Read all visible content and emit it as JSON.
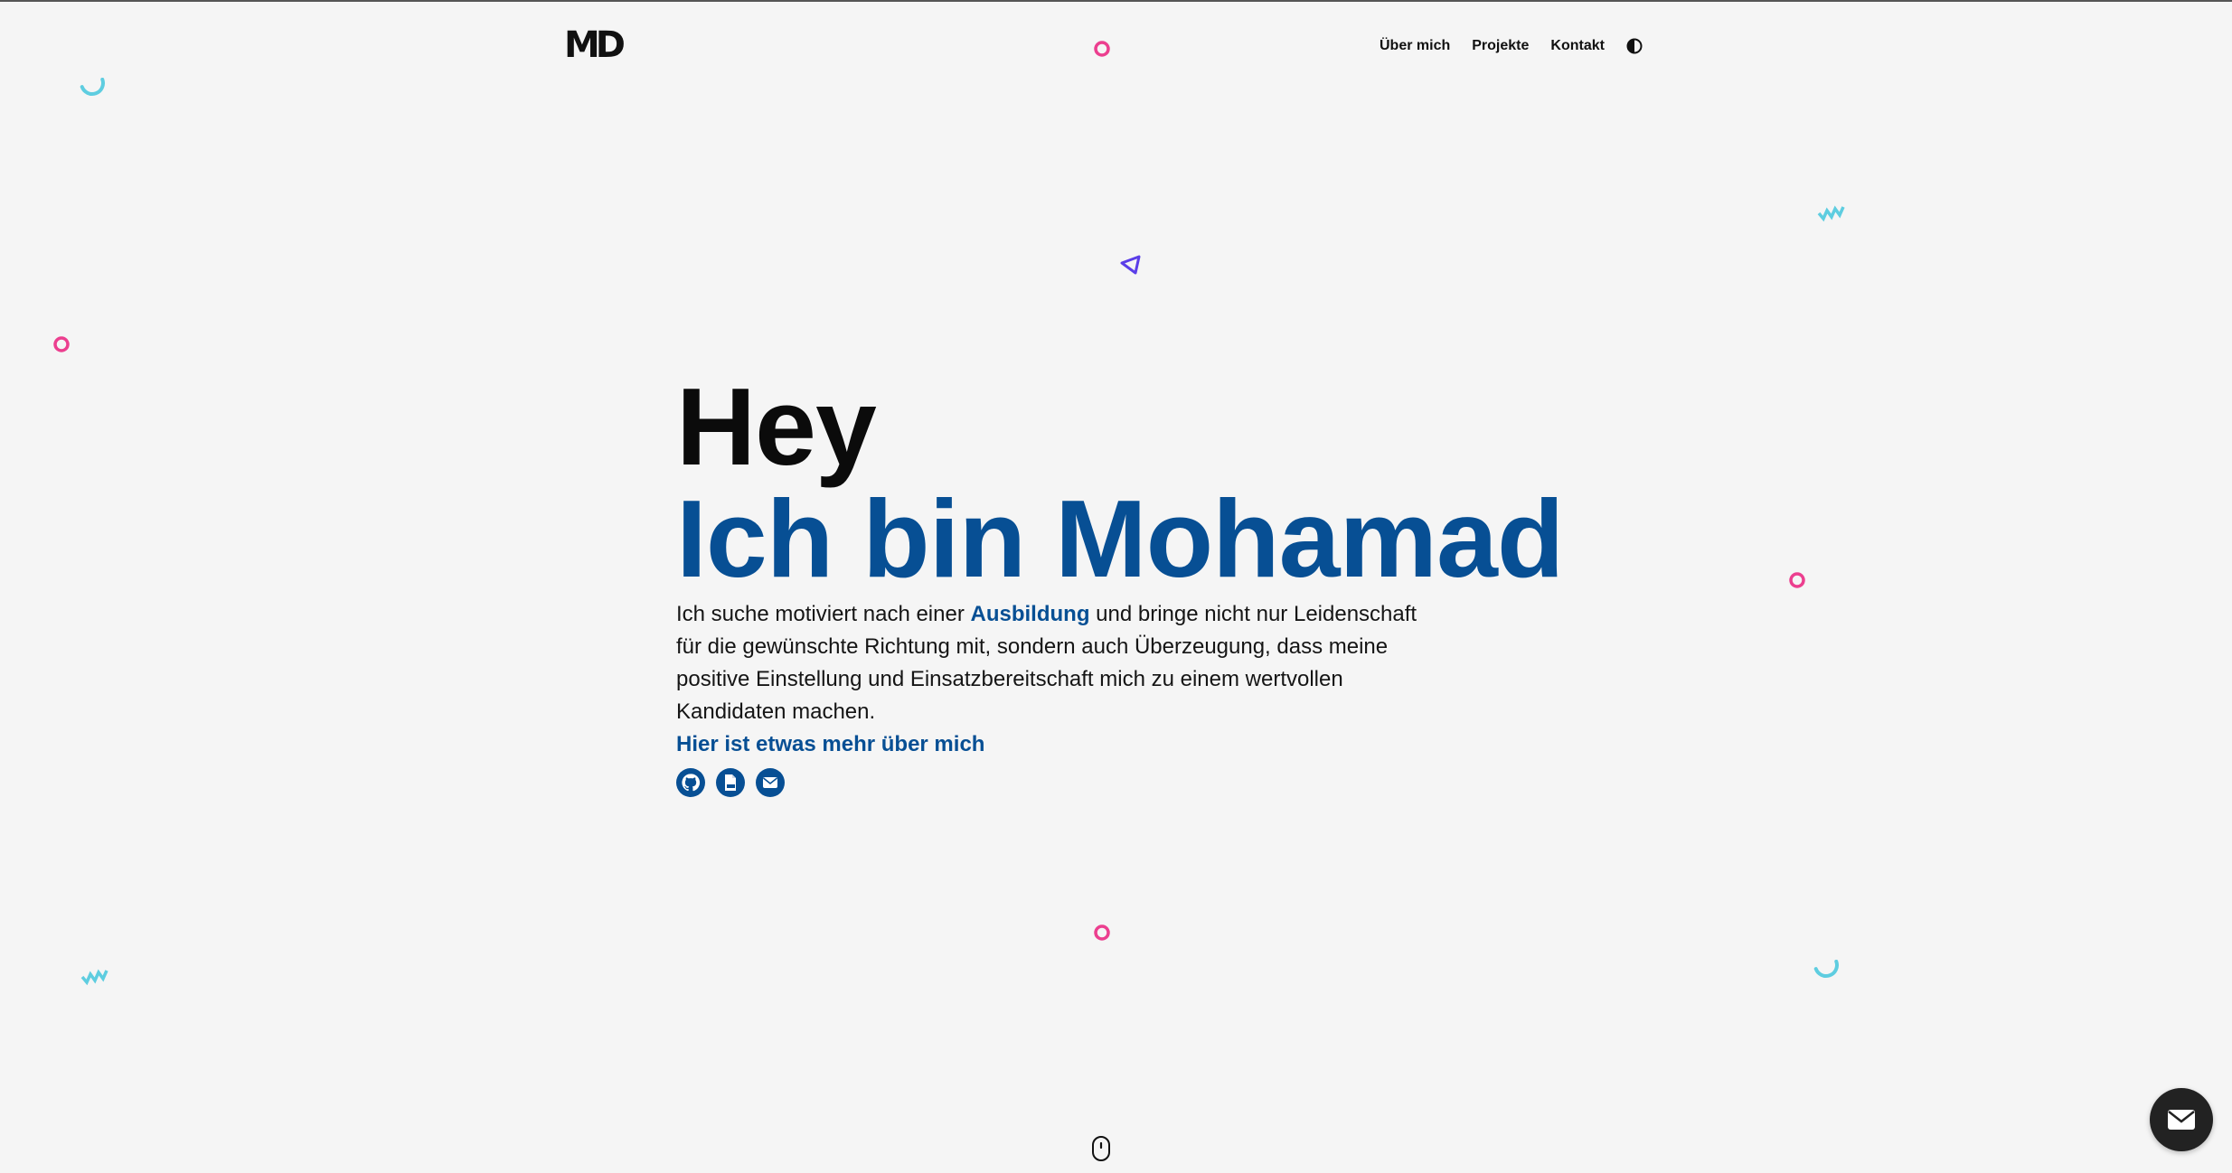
{
  "header": {
    "logo": "MD",
    "nav": [
      {
        "label": "Über mich"
      },
      {
        "label": "Projekte"
      },
      {
        "label": "Kontakt"
      }
    ],
    "theme_toggle_icon": "contrast-icon"
  },
  "hero": {
    "greeting": "Hey",
    "name": "Ich bin Mohamad",
    "intro_before": "Ich suche motiviert nach einer ",
    "intro_highlight": "Ausbildung",
    "intro_after": " und bringe nicht nur Leidenschaft für die gewünschte Richtung mit, sondern auch Überzeugung, dass meine positive Einstellung und Einsatzbereitschaft mich zu einem wertvollen Kandidaten machen.",
    "more_link": "Hier ist etwas mehr über mich",
    "socials": [
      {
        "icon": "github-icon"
      },
      {
        "icon": "pdf-file-icon"
      },
      {
        "icon": "mail-icon"
      }
    ]
  },
  "scroll_indicator_icon": "mouse-scroll-icon",
  "contact_fab_icon": "envelope-icon",
  "colors": {
    "background": "#f5f5f5",
    "accent": "#074f94",
    "text": "#111111",
    "deco_pink": "#ec3f8f",
    "deco_cyan": "#5ecde0",
    "deco_purple": "#5b3ee8"
  }
}
